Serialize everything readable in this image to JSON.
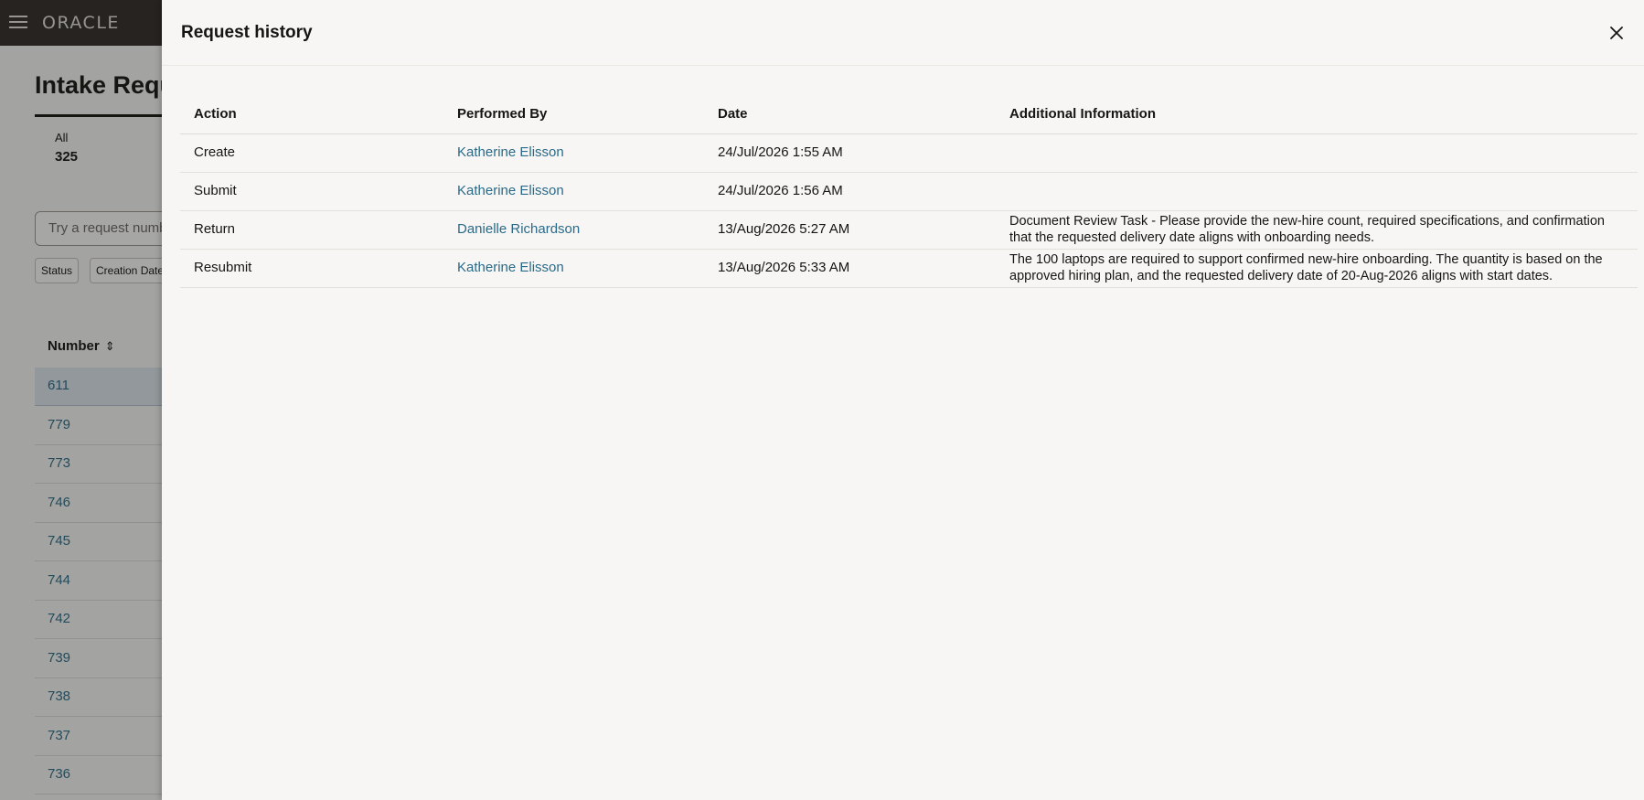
{
  "app": {
    "brand": "ORACLE",
    "page_title": "Intake Requ",
    "count_label": "All",
    "count_value": "325",
    "search_placeholder": "Try a request numb",
    "filters": [
      "Status",
      "Creation Date"
    ],
    "number_column_header": "Number",
    "rows": [
      "611",
      "779",
      "773",
      "746",
      "745",
      "744",
      "742",
      "739",
      "738",
      "737",
      "736"
    ]
  },
  "drawer": {
    "title": "Request history",
    "columns": [
      "Action",
      "Performed By",
      "Date",
      "Additional Information"
    ],
    "entries": [
      {
        "action": "Create",
        "performed_by": "Katherine Elisson",
        "date": "24/Jul/2026 1:55 AM",
        "info": ""
      },
      {
        "action": "Submit",
        "performed_by": "Katherine Elisson",
        "date": "24/Jul/2026 1:56 AM",
        "info": ""
      },
      {
        "action": "Return",
        "performed_by": "Danielle Richardson",
        "date": "13/Aug/2026 5:27 AM",
        "info": "Document Review Task - Please provide the new-hire count, required specifications, and confirmation that the requested delivery date aligns with onboarding needs."
      },
      {
        "action": "Resubmit",
        "performed_by": "Katherine Elisson",
        "date": "13/Aug/2026 5:33 AM",
        "info": "The 100 laptops are required to support confirmed new-hire onboarding. The quantity is based on the approved hiring plan, and the requested delivery date of 20-Aug-2026 aligns with start dates."
      }
    ]
  },
  "colors": {
    "topbar": "#312d2a",
    "link": "#2a6a88",
    "drawer_bg": "#f7f6f4"
  },
  "icons": {
    "menu": "hamburger-menu-icon",
    "close": "close-icon",
    "sort": "sort-icon"
  }
}
